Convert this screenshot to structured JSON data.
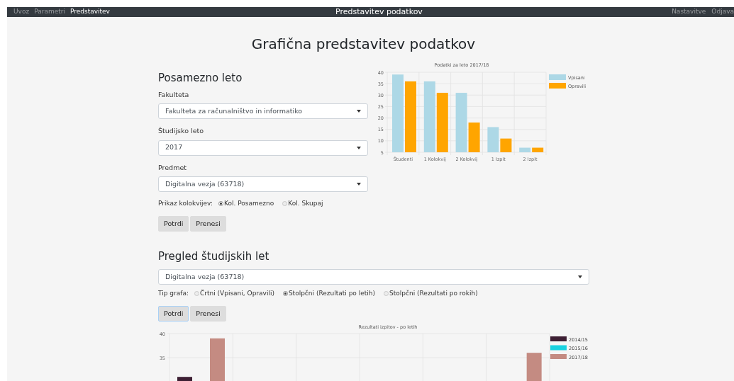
{
  "navbar": {
    "links": [
      {
        "label": "Uvoz",
        "selected": false
      },
      {
        "label": "Parametri",
        "selected": false
      },
      {
        "label": "Predstavitev",
        "selected": true
      }
    ],
    "title": "Predstavitev podatkov",
    "right_links": [
      "Nastavitve",
      "Odjava"
    ]
  },
  "page_title": "Grafična predstavitev podatkov",
  "single_year": {
    "heading": "Posamezno leto",
    "fields": [
      {
        "label": "Fakulteta",
        "value": "Fakulteta za računalništvo in informatiko"
      },
      {
        "label": "Študijsko leto",
        "value": "2017"
      },
      {
        "label": "Predmet",
        "value": "Digitalna vezja (63718)"
      }
    ],
    "radio_group": {
      "label": "Prikaz kolokvijev:",
      "options": [
        {
          "label": "Kol. Posamezno",
          "selected": true
        },
        {
          "label": "Kol. Skupaj",
          "selected": false
        }
      ]
    },
    "buttons": [
      {
        "label": "Potrdi",
        "focused": false
      },
      {
        "label": "Prenesi",
        "focused": false
      }
    ],
    "chart_data": {
      "type": "bar",
      "grid": true,
      "legend": "right",
      "title": "Podatki za leto 2017/18",
      "categories": [
        "Študenti",
        "1 Kolokvij",
        "2 Kolokvij",
        "1 Izpit",
        "2 Izpit"
      ],
      "ylim": [
        5,
        40
      ],
      "yticks": [
        5,
        10,
        15,
        20,
        25,
        30,
        35,
        40
      ],
      "series": [
        {
          "name": "Vpisani",
          "color": "#add8e6",
          "values": [
            39,
            36,
            31,
            16,
            7
          ]
        },
        {
          "name": "Opravili",
          "color": "#ffa500",
          "values": [
            36,
            31,
            18,
            11,
            7
          ]
        }
      ]
    }
  },
  "overview": {
    "heading": "Pregled študijskih let",
    "subject": {
      "value": "Digitalna vezja (63718)"
    },
    "radio_group": {
      "label": "Tip grafa:",
      "options": [
        {
          "label": "Črtni (Vpisani, Opravili)",
          "selected": false
        },
        {
          "label": "Stolpčni (Rezultati po letih)",
          "selected": true
        },
        {
          "label": "Stolpčni (Rezultati po rokih)",
          "selected": false
        }
      ]
    },
    "buttons": [
      {
        "label": "Potrdi",
        "focused": true
      },
      {
        "label": "Prenesi",
        "focused": false
      }
    ],
    "chart_data": {
      "type": "bar",
      "grid": true,
      "legend": "right",
      "title": "Rezultati izpitov - po letih",
      "ylim": [
        0,
        40
      ],
      "yticks": [
        35,
        40
      ],
      "series": [
        {
          "name": "2014/15",
          "color": "#3d1f33",
          "values": [
            31,
            null,
            null,
            null,
            null,
            null
          ]
        },
        {
          "name": "2015/16",
          "color": "#1ad1e0",
          "values": [
            null,
            null,
            null,
            null,
            null,
            null
          ]
        },
        {
          "name": "2017/18",
          "color": "#c48b82",
          "values": [
            39,
            null,
            null,
            null,
            null,
            36
          ]
        }
      ]
    }
  }
}
